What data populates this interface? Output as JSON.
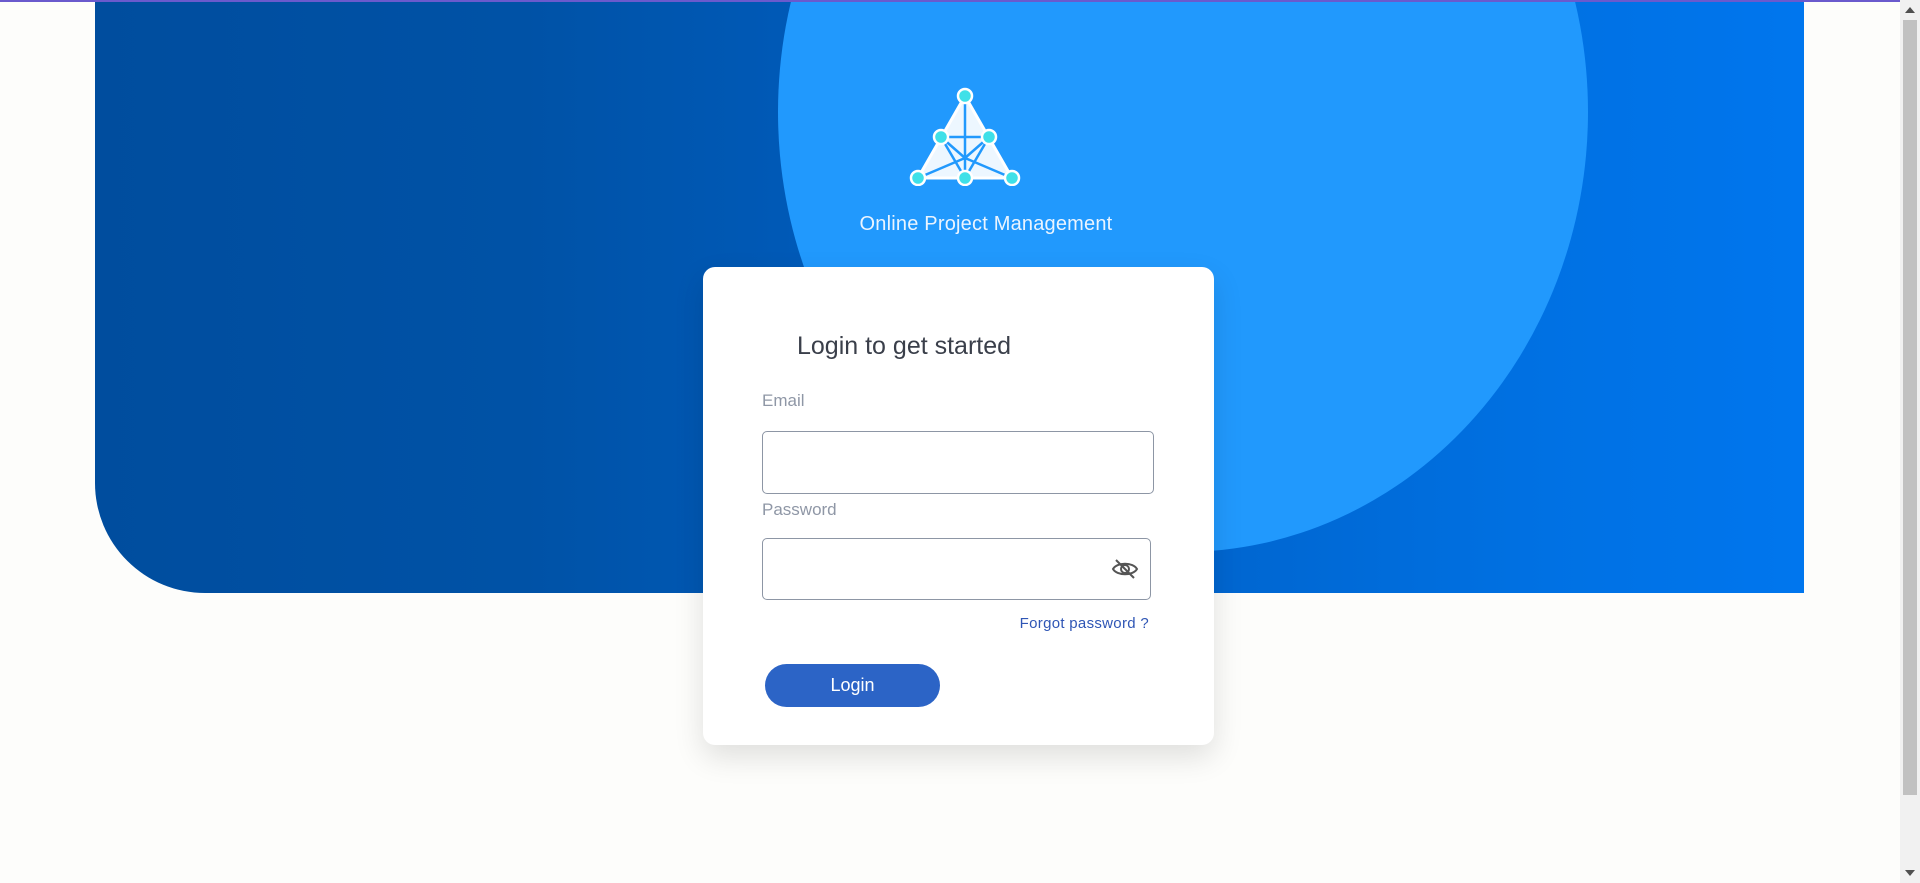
{
  "app": {
    "title": "Online Project Management",
    "logo_icon": "network-triangle-logo-icon"
  },
  "login": {
    "heading": "Login to get started",
    "email_label": "Email",
    "email_value": "",
    "password_label": "Password",
    "password_value": "",
    "toggle_password_icon": "eye-slash-icon",
    "forgot_password": "Forgot password ?",
    "submit_label": "Login"
  },
  "colors": {
    "hero_dark": "#004d9e",
    "hero_light": "#0076ee",
    "hero_circle": "#2199fd",
    "button": "#2c64c6",
    "link": "#2f56b5"
  }
}
